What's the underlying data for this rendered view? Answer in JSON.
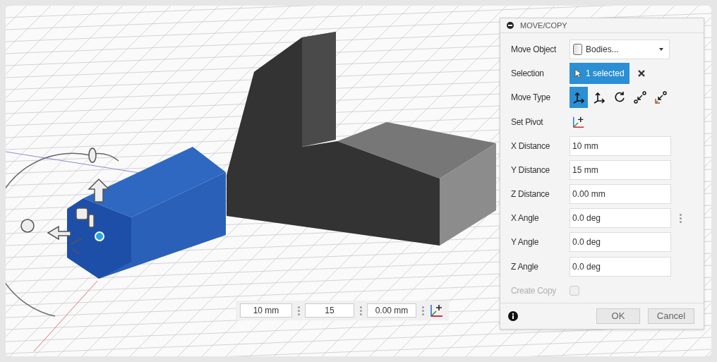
{
  "dialog": {
    "title": "MOVE/COPY",
    "rows": [
      {
        "kind": "dropdown",
        "label": "Move Object",
        "value": "Bodies..."
      },
      {
        "kind": "selection",
        "label": "Selection",
        "value": "1 selected"
      },
      {
        "kind": "movetype",
        "label": "Move Type",
        "options": [
          {
            "selected": true
          },
          {
            "selected": false
          },
          {
            "selected": false
          },
          {
            "selected": false
          },
          {
            "selected": false
          }
        ]
      },
      {
        "kind": "pivot",
        "label": "Set Pivot"
      },
      {
        "kind": "field",
        "label": "X Distance",
        "value": "10 mm"
      },
      {
        "kind": "field",
        "label": "Y Distance",
        "value": "15 mm"
      },
      {
        "kind": "field",
        "label": "Z Distance",
        "value": "0.00 mm"
      },
      {
        "kind": "field",
        "label": "X Angle",
        "value": "0.0 deg",
        "more": true
      },
      {
        "kind": "field",
        "label": "Y Angle",
        "value": "0.0 deg"
      },
      {
        "kind": "field",
        "label": "Z Angle",
        "value": "0.0 deg"
      },
      {
        "kind": "checkbox",
        "label": "Create Copy",
        "checked": false,
        "disabled": true
      }
    ],
    "buttons": [
      "OK",
      "Cancel"
    ]
  },
  "toolbar": {
    "fields": [
      "10 mm",
      "15",
      "0.00 mm"
    ]
  }
}
